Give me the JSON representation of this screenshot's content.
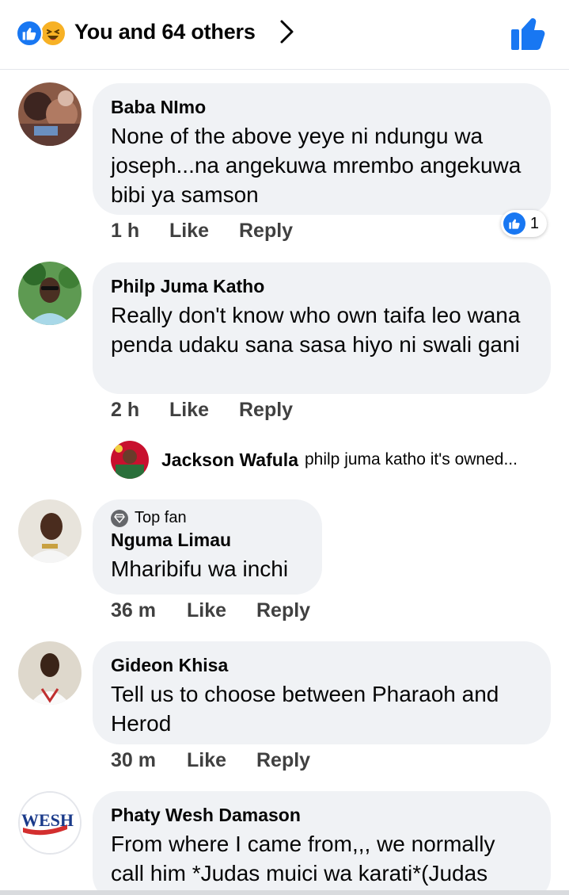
{
  "header": {
    "reaction_summary": "You and 64 others",
    "reaction_icons": [
      "like-reaction-icon",
      "haha-reaction-icon"
    ],
    "chevron_icon": "chevron-right-icon",
    "like_button_icon": "thumbs-up-icon"
  },
  "colors": {
    "accent": "#1877f2",
    "bubble": "#f0f2f5",
    "haha": "#f7b125",
    "meta": "#404040"
  },
  "comments": [
    {
      "author": "Baba NImo",
      "text": "None of the above yeye ni ndungu wa joseph...na angekuwa mrembo angekuwa bibi ya samson",
      "time": "1 h",
      "like_label": "Like",
      "reply_label": "Reply",
      "reaction_count": "1"
    },
    {
      "author": "Philp Juma Katho",
      "text": "Really don't know who own taifa leo wana penda udaku sana sasa hiyo ni swali gani",
      "time": "2 h",
      "like_label": "Like",
      "reply_label": "Reply",
      "reply_preview": {
        "author": "Jackson Wafula",
        "text": "philp juma katho it's owned..."
      }
    },
    {
      "badge": "Top fan",
      "author": "Nguma Limau",
      "text": "Mharibifu wa inchi",
      "time": "36 m",
      "like_label": "Like",
      "reply_label": "Reply"
    },
    {
      "author": "Gideon Khisa",
      "text": "Tell us to choose between Pharaoh and Herod",
      "time": "30 m",
      "like_label": "Like",
      "reply_label": "Reply"
    },
    {
      "author": "Phaty Wesh Damason",
      "avatar_text": "WESH",
      "text": "From where I came from,,, we normally call him *Judas muici wa  karati*(Judas"
    }
  ]
}
